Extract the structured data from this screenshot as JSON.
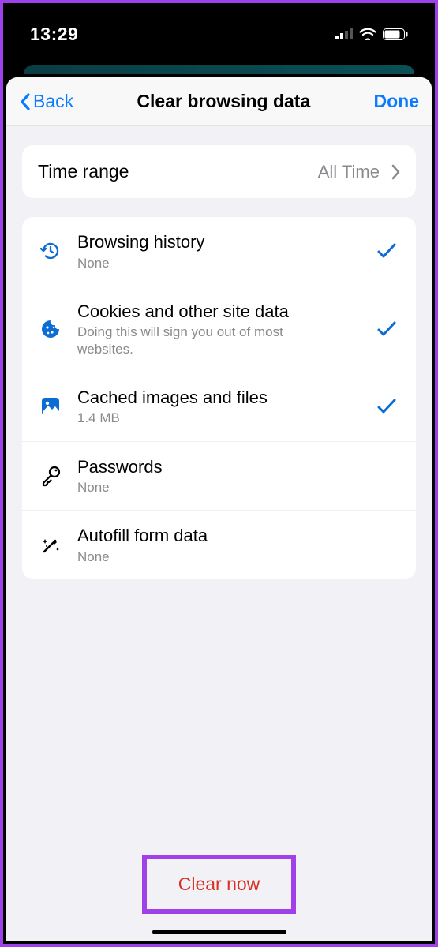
{
  "statusbar": {
    "time": "13:29"
  },
  "nav": {
    "back": "Back",
    "title": "Clear browsing data",
    "done": "Done"
  },
  "timerange": {
    "label": "Time range",
    "value": "All Time"
  },
  "items": [
    {
      "icon": "history",
      "title": "Browsing history",
      "sub": "None",
      "checked": true
    },
    {
      "icon": "cookie",
      "title": "Cookies and other site data",
      "sub": "Doing this will sign you out of most websites.",
      "checked": true
    },
    {
      "icon": "image",
      "title": "Cached images and files",
      "sub": "1.4 MB",
      "checked": true
    },
    {
      "icon": "key",
      "title": "Passwords",
      "sub": "None",
      "checked": false
    },
    {
      "icon": "wand",
      "title": "Autofill form data",
      "sub": "None",
      "checked": false
    }
  ],
  "clear": {
    "label": "Clear now"
  }
}
